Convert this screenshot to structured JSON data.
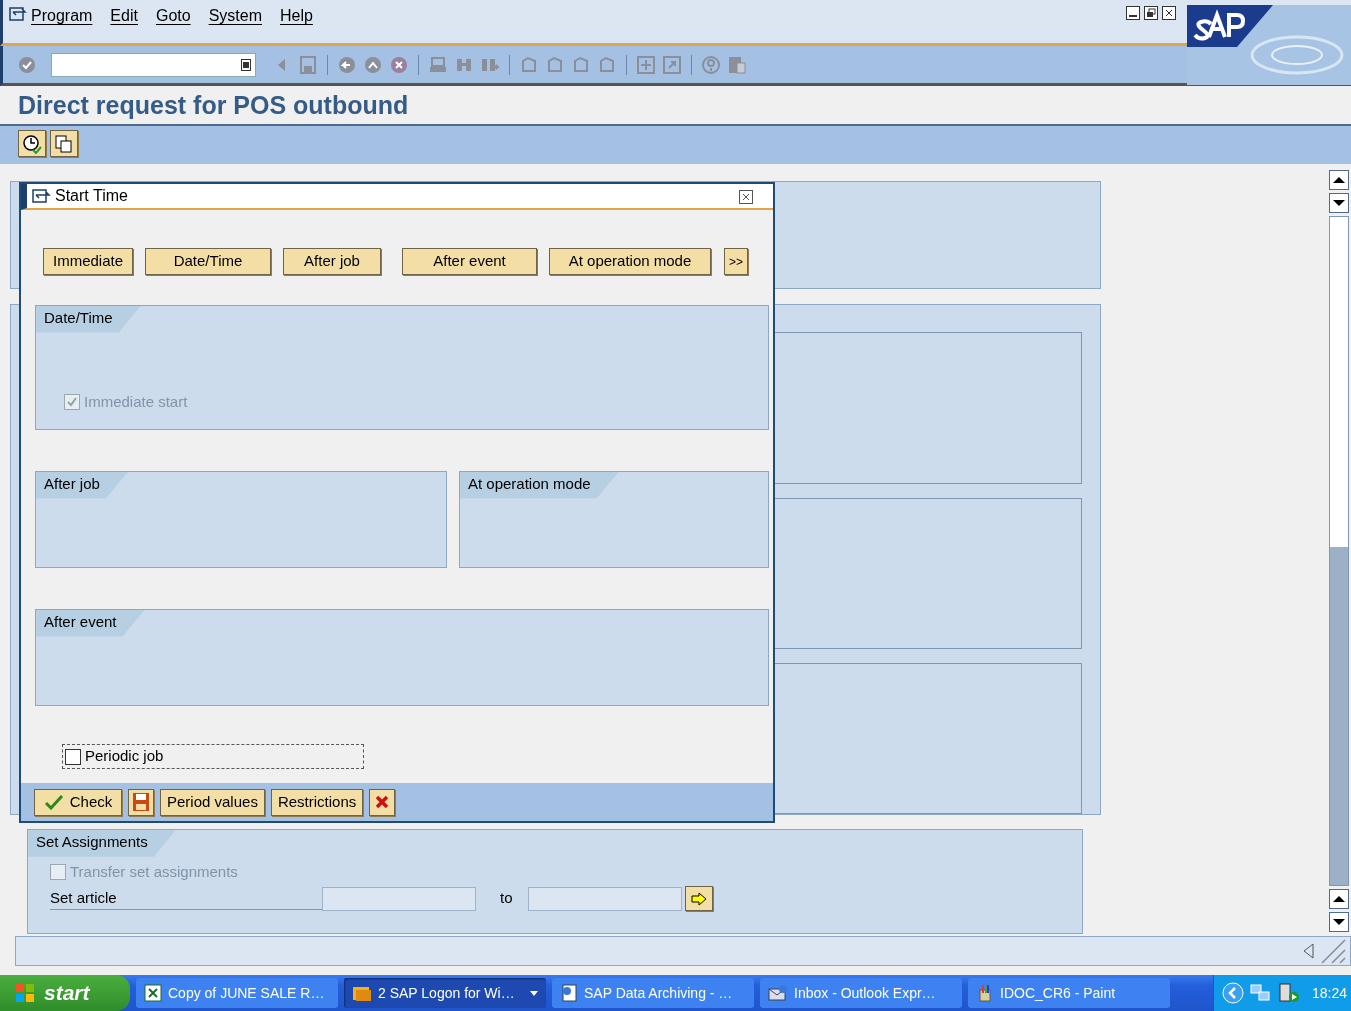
{
  "menu": [
    {
      "label": "Program"
    },
    {
      "label": "Edit"
    },
    {
      "label": "Goto"
    },
    {
      "label": "System"
    },
    {
      "label": "Help"
    }
  ],
  "title": "Direct request for POS outbound",
  "dialog": {
    "title": "Start Time",
    "start_buttons": [
      {
        "label": "Immediate"
      },
      {
        "label": "Date/Time"
      },
      {
        "label": "After job"
      },
      {
        "label": "After event"
      },
      {
        "label": "At operation mode"
      },
      {
        "label": ">>"
      }
    ],
    "groups": [
      {
        "kind": "full",
        "title": "Date/Time",
        "checkbox": {
          "label": "Immediate start",
          "checked": true,
          "disabled": true
        }
      },
      {
        "kind": "left",
        "title": "After job"
      },
      {
        "kind": "right",
        "title": "At operation mode"
      },
      {
        "kind": "full",
        "title": "After event"
      }
    ],
    "periodic_job": {
      "label": "Periodic job",
      "checked": false
    },
    "footer_buttons": [
      {
        "kind": "check",
        "label": "Check"
      },
      {
        "kind": "save"
      },
      {
        "kind": "text",
        "label": "Period values"
      },
      {
        "kind": "text",
        "label": "Restrictions"
      },
      {
        "kind": "cancel"
      }
    ]
  },
  "set_assignments": {
    "title": "Set Assignments",
    "checkbox": {
      "label": "Transfer set assignments",
      "checked": false,
      "disabled": true
    },
    "rows": [
      {
        "label": "Set article",
        "to": "to"
      }
    ]
  },
  "taskbar": {
    "start": "start",
    "tasks": [
      {
        "kind": "excel",
        "label": "Copy of JUNE SALE R…",
        "selected": false
      },
      {
        "kind": "group",
        "label": "2 SAP Logon for Wi…",
        "selected": true
      },
      {
        "kind": "doc",
        "label": "SAP Data Archiving - …",
        "selected": false
      },
      {
        "kind": "mail",
        "label": "Inbox - Outlook Expr…",
        "selected": false
      },
      {
        "kind": "paint",
        "label": "IDOC_CR6 - Paint",
        "selected": false
      }
    ],
    "clock": "18:24"
  }
}
